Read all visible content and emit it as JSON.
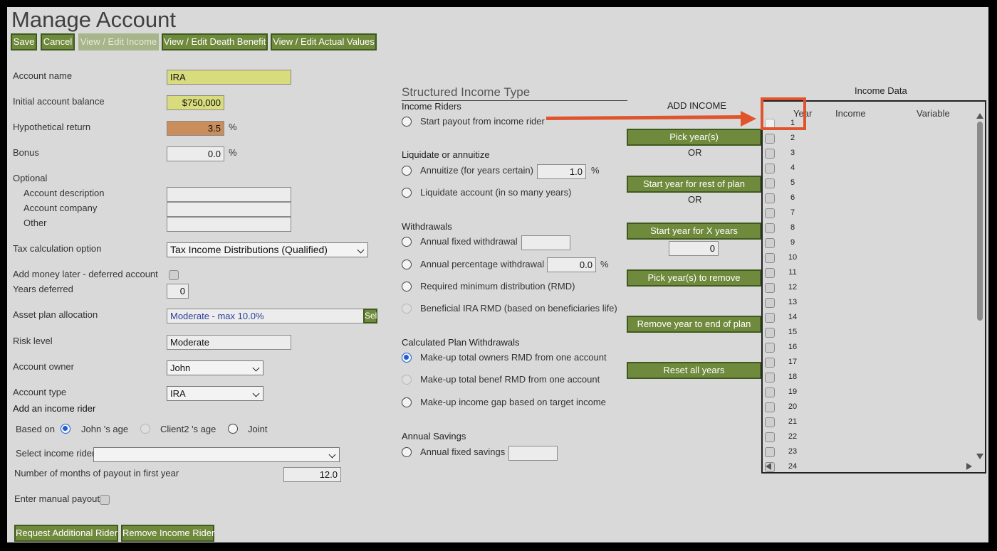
{
  "page_title": "Manage Account",
  "toolbar": {
    "save": "Save",
    "cancel": "Cancel",
    "view_income": "View / Edit Income",
    "view_death": "View / Edit Death Benefit",
    "view_actual": "View / Edit Actual Values"
  },
  "form": {
    "account_name_label": "Account name",
    "account_name_value": "IRA",
    "initial_balance_label": "Initial account balance",
    "initial_balance_value": "$750,000",
    "hyp_return_label": "Hypothetical return",
    "hyp_return_value": "3.5",
    "percent": "%",
    "bonus_label": "Bonus",
    "bonus_value": "0.0",
    "optional_label": "Optional",
    "acct_desc_label": "Account description",
    "acct_company_label": "Account company",
    "other_label": "Other",
    "tax_label": "Tax calculation option",
    "tax_value": "Tax Income Distributions (Qualified)",
    "add_money_label": "Add money later - deferred account",
    "years_deferred_label": "Years deferred",
    "years_deferred_value": "0",
    "asset_plan_label": "Asset plan allocation",
    "asset_plan_value": "Moderate - max 10.0%",
    "asset_plan_sel": "Sel",
    "risk_label": "Risk level",
    "risk_value": "Moderate",
    "owner_label": "Account owner",
    "owner_value": "John",
    "type_label": "Account type",
    "type_value": "IRA"
  },
  "rider": {
    "heading": "Add an income rider",
    "based_on_label": "Based on",
    "opt_john": "John 's age",
    "opt_client2": "Client2 's age",
    "opt_joint": "Joint",
    "select_label": "Select income rider",
    "select_value": "",
    "months_label": "Number of months of payout in first year",
    "months_value": "12.0",
    "manual_label": "Enter manual payout",
    "request_btn": "Request Additional Rider",
    "remove_btn": "Remove Income Rider"
  },
  "structured": {
    "title": "Structured Income Type",
    "income_riders_heading": "Income Riders",
    "start_payout": "Start payout from income rider",
    "liquidate_heading": "Liquidate or annuitize",
    "annuitize": "Annuitize (for years certain)",
    "annuitize_value": "1.0",
    "liquidate": "Liquidate account (in so many years)",
    "withdrawals_heading": "Withdrawals",
    "annual_fixed": "Annual fixed withdrawal",
    "annual_fixed_value": "",
    "annual_pct": "Annual percentage withdrawal",
    "annual_pct_value": "0.0",
    "rmd": "Required minimum distribution (RMD)",
    "beneficial_rmd": "Beneficial IRA RMD (based on beneficiaries life)",
    "calc_heading": "Calculated Plan Withdrawals",
    "makeup_owner": "Make-up total owners RMD from one account",
    "makeup_benef": "Make-up total benef RMD from one account",
    "makeup_gap": "Make-up income gap based on target income",
    "savings_heading": "Annual Savings",
    "annual_savings": "Annual fixed savings",
    "annual_savings_value": ""
  },
  "add_income": {
    "heading": "ADD INCOME",
    "pick_years": "Pick year(s)",
    "or": "OR",
    "start_rest": "Start year for rest of plan",
    "start_x": "Start year for X years",
    "x_value": "0",
    "pick_remove": "Pick year(s) to remove",
    "remove_end": "Remove year to end of plan",
    "reset_all": "Reset all years"
  },
  "income_data": {
    "title": "Income Data",
    "col_year": "Year",
    "col_income": "Income",
    "col_variable": "Variable",
    "years": [
      "1",
      "2",
      "3",
      "4",
      "5",
      "6",
      "7",
      "8",
      "9",
      "10",
      "11",
      "12",
      "13",
      "14",
      "15",
      "16",
      "17",
      "18",
      "19",
      "20",
      "21",
      "22",
      "23",
      "24"
    ]
  }
}
